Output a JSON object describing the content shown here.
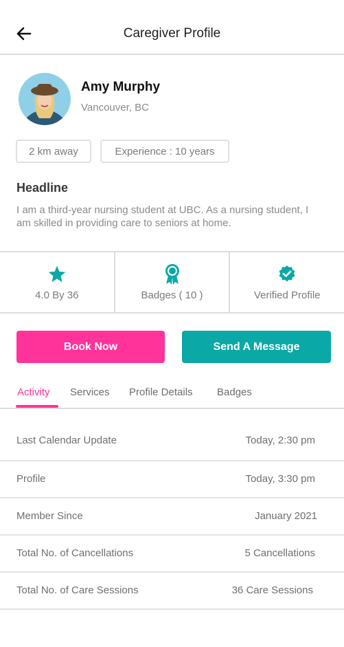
{
  "header": {
    "title": "Caregiver Profile",
    "back_icon": "arrow-left-icon"
  },
  "profile": {
    "name": "Amy Murphy",
    "location": "Vancouver, BC",
    "distance": "2 km away",
    "experience": "Experience : 10 years",
    "headline_title": "Headline",
    "headline_text": "I am a third-year nursing student at UBC. As a nursing student, I am skilled in providing care to seniors at home."
  },
  "stats": {
    "rating": {
      "label": "4.0 By 36",
      "icon": "star-icon"
    },
    "badges": {
      "label": "Badges ( 10 )",
      "icon": "award-ribbon-icon"
    },
    "verified": {
      "label": "Verified Profile",
      "icon": "verified-badge-icon"
    }
  },
  "actions": {
    "book_label": "Book Now",
    "message_label": "Send A Message"
  },
  "tabs": [
    {
      "label": "Activity",
      "active": true
    },
    {
      "label": "Services"
    },
    {
      "label": "Profile Details"
    },
    {
      "label": "Badges"
    }
  ],
  "activity": [
    {
      "label": "Last Calendar Update",
      "value": "Today, 2:30 pm"
    },
    {
      "label": "Profile",
      "value": "Today, 3:30 pm"
    },
    {
      "label": "Member Since",
      "value": "January 2021"
    },
    {
      "label": "Total No. of Cancellations",
      "value": "5 Cancellations"
    },
    {
      "label": "Total No. of Care Sessions",
      "value": "36 Care Sessions"
    }
  ],
  "colors": {
    "accent_pink": "#ff3399",
    "accent_teal": "#0aa8a6"
  }
}
